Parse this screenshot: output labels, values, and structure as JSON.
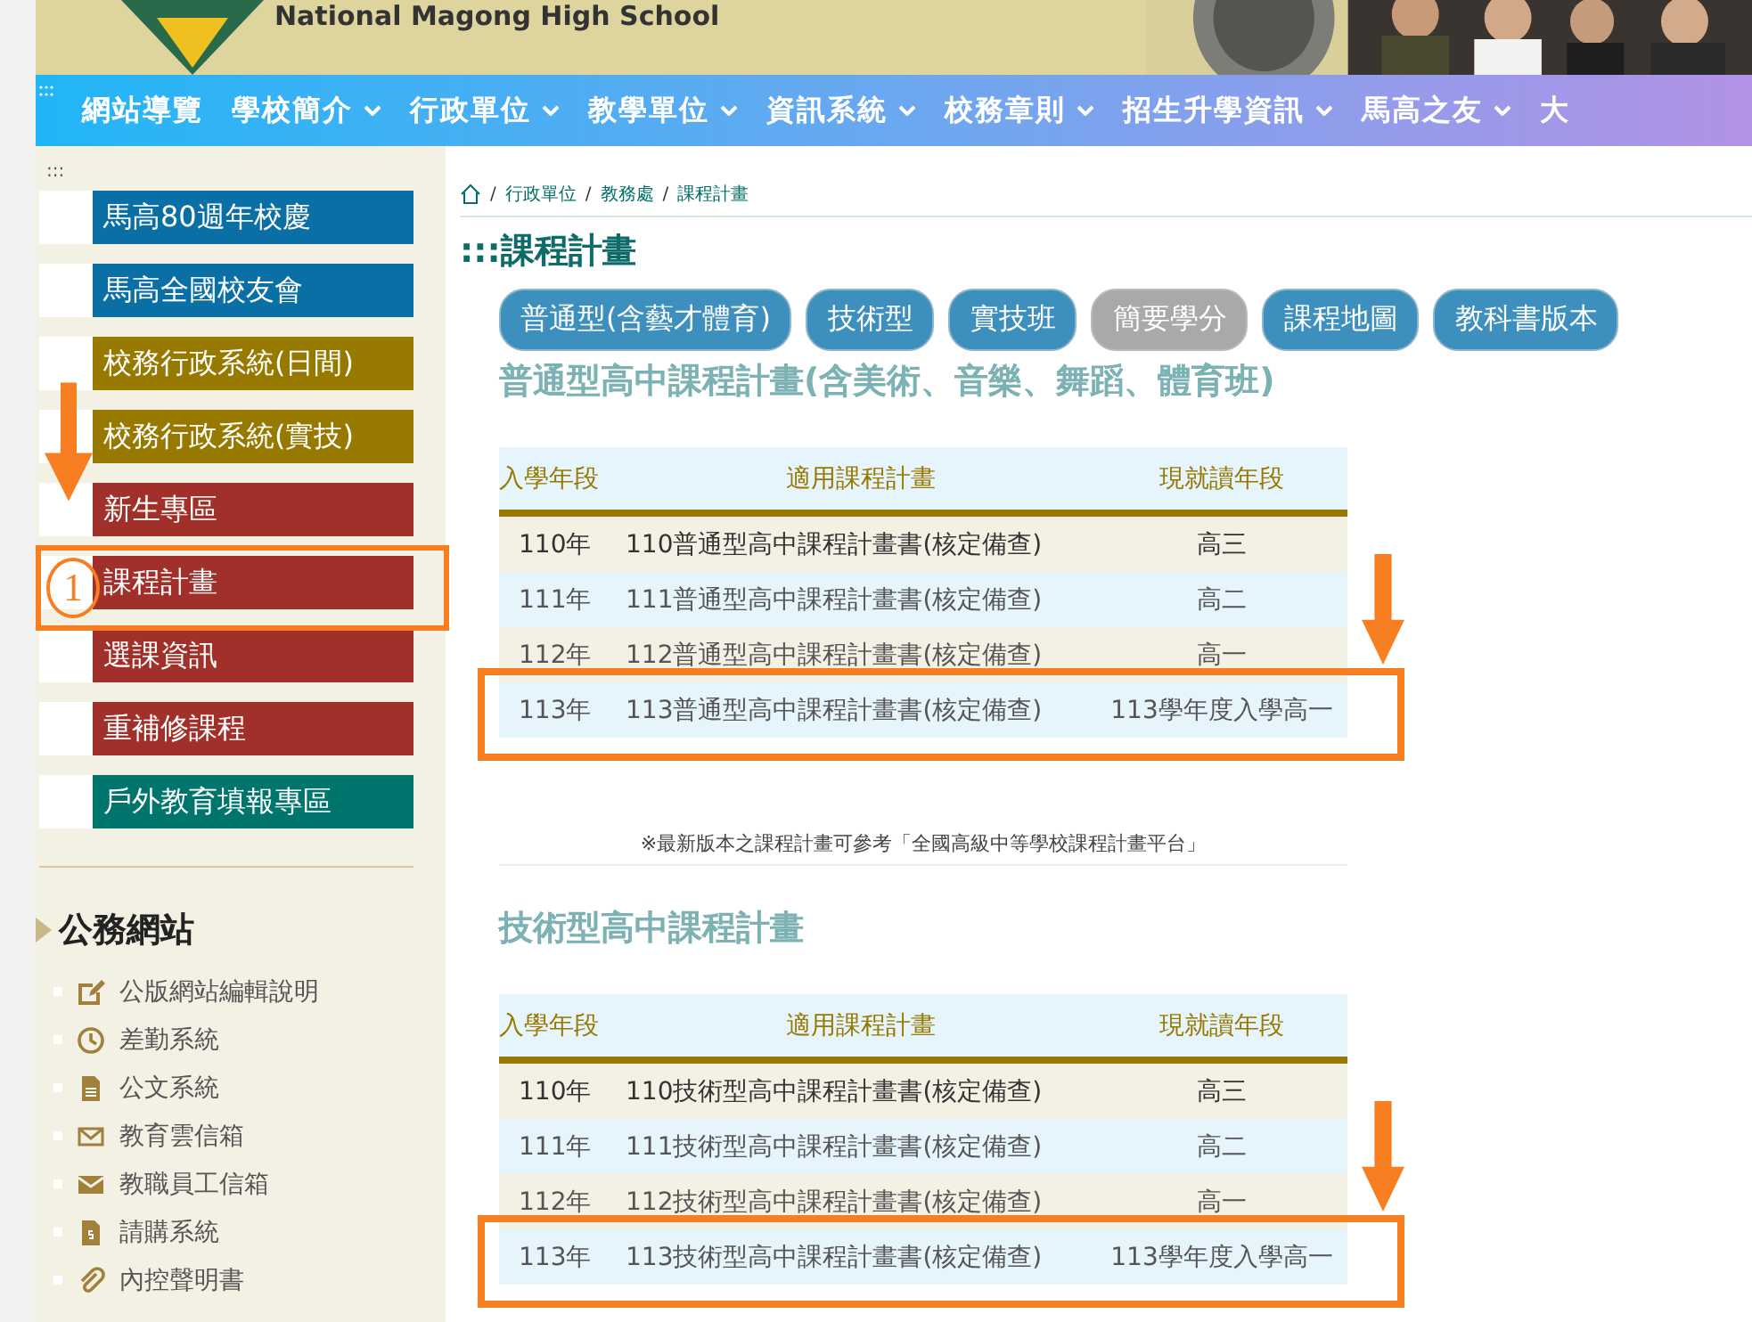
{
  "header": {
    "school_name_en": "National Magong High School"
  },
  "nav": [
    {
      "label": "網站導覽",
      "dropdown": false
    },
    {
      "label": "學校簡介",
      "dropdown": true
    },
    {
      "label": "行政單位",
      "dropdown": true
    },
    {
      "label": "教學單位",
      "dropdown": true
    },
    {
      "label": "資訊系統",
      "dropdown": true
    },
    {
      "label": "校務章則",
      "dropdown": true
    },
    {
      "label": "招生升學資訊",
      "dropdown": true
    },
    {
      "label": "馬高之友",
      "dropdown": true
    },
    {
      "label": "大",
      "dropdown": false
    }
  ],
  "sidebar": {
    "marker": ":::",
    "links": [
      {
        "label": "馬高80週年校慶",
        "color": "#0a6fa5"
      },
      {
        "label": "馬高全國校友會",
        "color": "#0a6fa5"
      },
      {
        "label": "校務行政系統(日間)",
        "color": "#977900"
      },
      {
        "label": "校務行政系統(實技)",
        "color": "#977900"
      },
      {
        "label": "新生專區",
        "color": "#a03029"
      },
      {
        "label": "課程計畫",
        "color": "#a03029"
      },
      {
        "label": "選課資訊",
        "color": "#a03029"
      },
      {
        "label": "重補修課程",
        "color": "#a03029"
      },
      {
        "label": "戶外教育填報專區",
        "color": "#00756e"
      }
    ],
    "section_title": "公務網站",
    "official_links": [
      {
        "label": "公版網站編輯說明",
        "kind": "edit"
      },
      {
        "label": "差勤系統",
        "kind": "clock"
      },
      {
        "label": "公文系統",
        "kind": "file"
      },
      {
        "label": "教育雲信箱",
        "kind": "mail-outline"
      },
      {
        "label": "教職員工信箱",
        "kind": "mail"
      },
      {
        "label": "請購系統",
        "kind": "invoice"
      },
      {
        "label": "內控聲明書",
        "kind": "clip"
      }
    ]
  },
  "breadcrumb": {
    "separator": "/",
    "items": [
      "行政單位",
      "教務處",
      "課程計畫"
    ]
  },
  "page_title": ":::課程計畫",
  "tabs": [
    {
      "label": "普通型(含藝才體育)",
      "disabled": false
    },
    {
      "label": "技術型",
      "disabled": false
    },
    {
      "label": "實技班",
      "disabled": false
    },
    {
      "label": "簡要學分",
      "disabled": true
    },
    {
      "label": "課程地圖",
      "disabled": false
    },
    {
      "label": "教科書版本",
      "disabled": false
    }
  ],
  "sections": [
    {
      "heading": "普通型高中課程計畫(含美術、音樂、舞蹈、體育班)",
      "columns": [
        "入學年段",
        "適用課程計畫",
        "現就讀年段"
      ],
      "rows": [
        [
          "110年",
          "110普通型高中課程計畫書(核定備查)",
          "高三"
        ],
        [
          "111年",
          "111普通型高中課程計畫書(核定備查)",
          "高二"
        ],
        [
          "112年",
          "112普通型高中課程計畫書(核定備查)",
          "高一"
        ],
        [
          "113年",
          "113普通型高中課程計畫書(核定備查)",
          "113學年度入學高一"
        ]
      ],
      "note": "※最新版本之課程計畫可參考「全國高級中等學校課程計畫平台」"
    },
    {
      "heading": "技術型高中課程計畫",
      "columns": [
        "入學年段",
        "適用課程計畫",
        "現就讀年段"
      ],
      "rows": [
        [
          "110年",
          "110技術型高中課程計畫書(核定備查)",
          "高三"
        ],
        [
          "111年",
          "111技術型高中課程計畫書(核定備查)",
          "高二"
        ],
        [
          "112年",
          "112技術型高中課程計畫書(核定備查)",
          "高一"
        ],
        [
          "113年",
          "113技術型高中課程計畫書(核定備查)",
          "113學年度入學高一"
        ]
      ]
    }
  ],
  "annotation": {
    "step_number": "1"
  }
}
